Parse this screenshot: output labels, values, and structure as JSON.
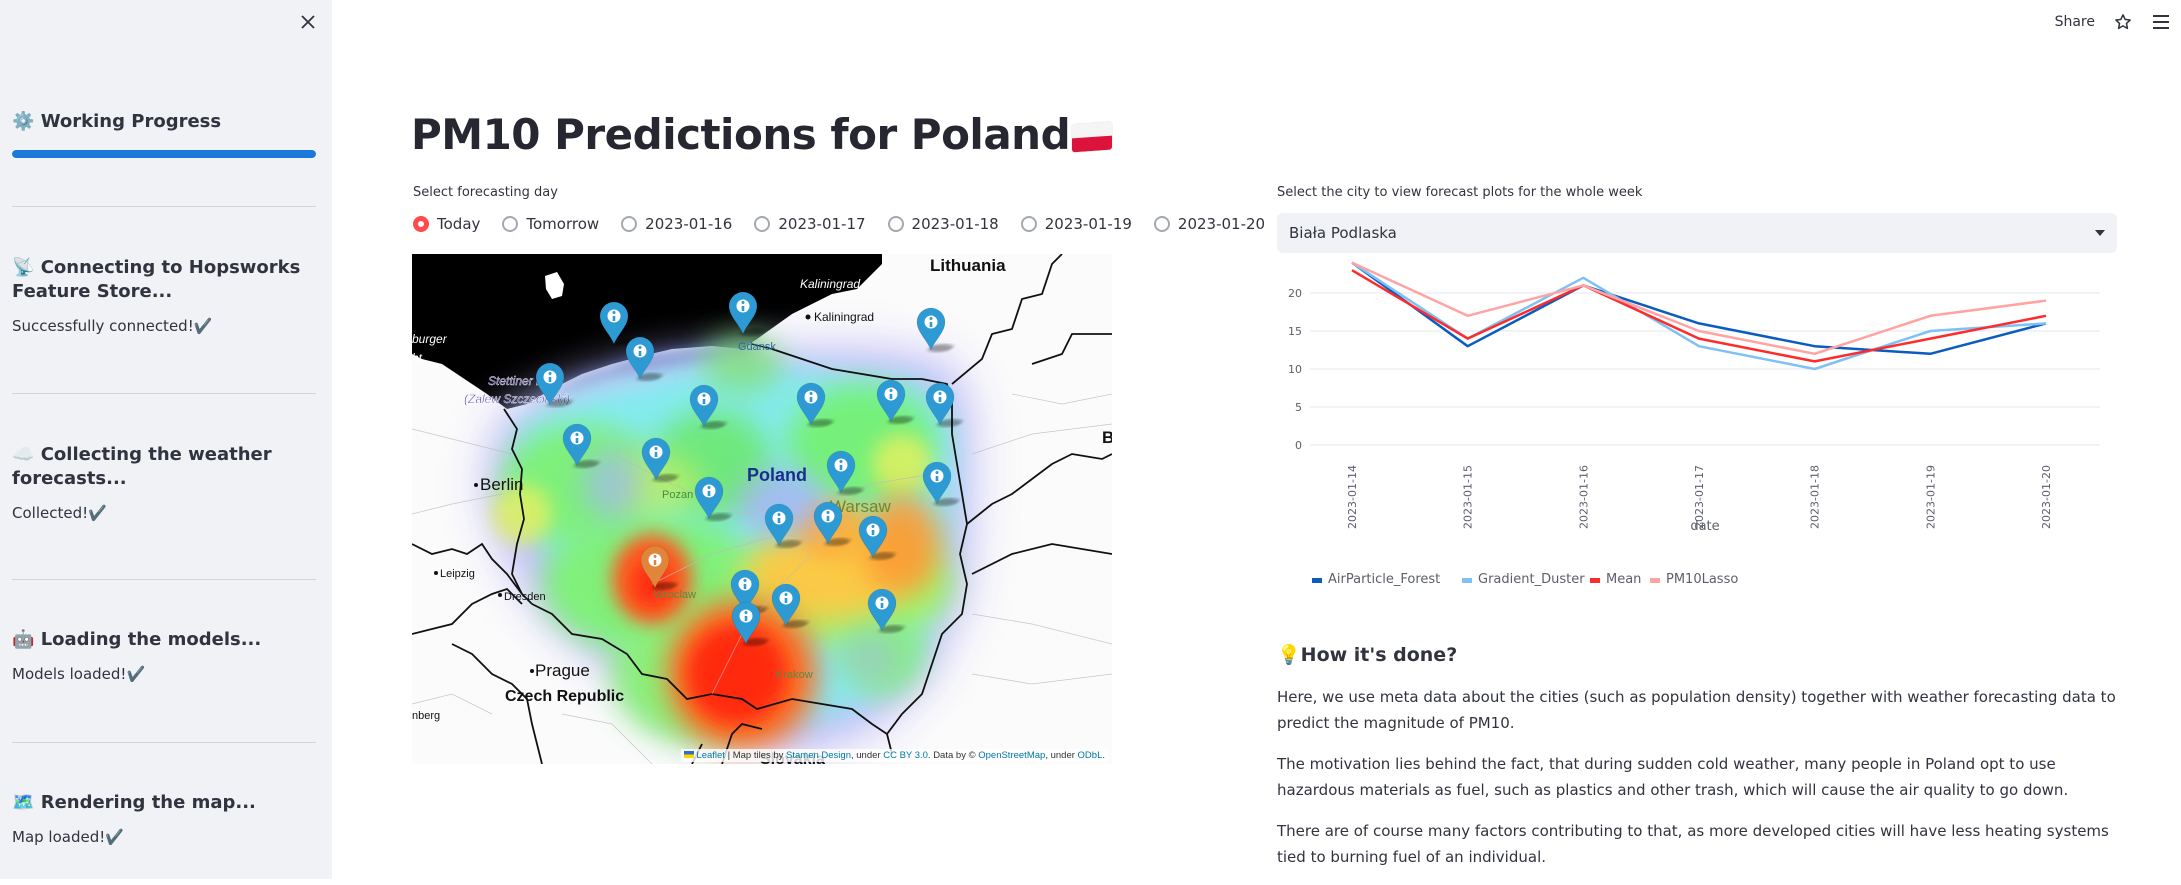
{
  "sidebar": {
    "close_icon": "close-icon",
    "progress_title": "Working Progress",
    "progress_icon": "gear-icon",
    "progress_value": 1.0,
    "sections": [
      {
        "icon": "satellite-dish-icon",
        "emoji": "📡",
        "title": "Connecting to Hopsworks Feature Store...",
        "status": "Successfully connected!✔️"
      },
      {
        "icon": "cloud-icon",
        "emoji": "☁️",
        "title": "Collecting the weather forecasts...",
        "status": "Collected!✔️"
      },
      {
        "icon": "robot-icon",
        "emoji": "🤖",
        "title": "Loading the models...",
        "status": "Models loaded!✔️"
      },
      {
        "icon": "map-icon",
        "emoji": "🗺️",
        "title": "Rendering the map...",
        "status": "Map loaded!✔️"
      }
    ]
  },
  "topbar": {
    "share_label": "Share",
    "star_icon": "star-icon",
    "menu_icon": "hamburger-menu-icon"
  },
  "main": {
    "title": "PM10 Predictions for Poland",
    "title_flag": "poland-flag-icon",
    "forecast_day_label": "Select forecasting day",
    "forecast_days": [
      {
        "label": "Today",
        "selected": true
      },
      {
        "label": "Tomorrow",
        "selected": false
      },
      {
        "label": "2023-01-16",
        "selected": false
      },
      {
        "label": "2023-01-17",
        "selected": false
      },
      {
        "label": "2023-01-18",
        "selected": false
      },
      {
        "label": "2023-01-19",
        "selected": false
      },
      {
        "label": "2023-01-20",
        "selected": false
      }
    ],
    "map": {
      "labels": {
        "lithuania": "Lithuania",
        "kaliningrad_region": "Kaliningrad",
        "kaliningrad_city": "Kaliningrad",
        "gdansk": "Gdansk",
        "stettiner_haff": "Stettiner Haff",
        "zalew": "(Zalew Szczecinski)",
        "burger": "burger",
        "ht": "ht.",
        "berlin": "Berlin",
        "poland": "Poland",
        "pozan": "Pozan",
        "warsaw": "Warsaw",
        "leipzig": "Leipzig",
        "dresden": "Dresden",
        "wroclaw": "Wroclaw",
        "krakow": "Krakow",
        "prague": "Prague",
        "czech": "Czech Republic",
        "nberg": "nberg",
        "slovakia": "Slovakia",
        "b": "B"
      },
      "attribution": {
        "leaflet": "Leaflet",
        "sep": " | Map tiles by ",
        "stamen": "Stamen Design",
        "under1": ", under ",
        "ccby": "CC BY 3.0",
        "databy": ". Data by © ",
        "osm": "OpenStreetMap",
        "under2": ", under ",
        "odbl": "ODbL",
        "end": "."
      },
      "marker_colors": {
        "default": "#2d9ad3",
        "highlight": "#e0853a"
      }
    },
    "city_select_label": "Select the city to view forecast plots for the whole week",
    "city_selected": "Biała Podlaska",
    "how": {
      "title": "How it's done?",
      "icon": "lightbulb-icon",
      "paragraphs": [
        "Here, we use meta data about the cities (such as population density) together with weather forecasting data to predict the magnitude of PM10.",
        "The motivation lies behind the fact, that during sudden cold weather, many people in Poland opt to use hazardous materials as fuel, such as plastics and other trash, which will cause the air quality to go down.",
        "There are of course many factors contributing to that, as more developed cities will have less heating systems tied to burning fuel of an individual."
      ]
    }
  },
  "chart_data": {
    "type": "line",
    "title": "",
    "xlabel": "date",
    "ylabel": "",
    "categories": [
      "2023-01-14",
      "2023-01-15",
      "2023-01-16",
      "2023-01-17",
      "2023-01-18",
      "2023-01-19",
      "2023-01-20"
    ],
    "yticks": [
      0,
      5,
      10,
      15,
      20
    ],
    "ylim": [
      0,
      25
    ],
    "grid": true,
    "legend": "bottom-left",
    "series": [
      {
        "name": "AirParticle_Forest",
        "color": "#0a5cbf",
        "values": [
          24,
          13,
          21,
          16,
          13,
          12,
          16
        ]
      },
      {
        "name": "Gradient_Duster",
        "color": "#7fc0f5",
        "values": [
          24,
          14,
          22,
          13,
          10,
          15,
          16
        ]
      },
      {
        "name": "Mean",
        "color": "#ff2b2b",
        "values": [
          23,
          14,
          21,
          14,
          11,
          14,
          17
        ]
      },
      {
        "name": "PM10Lasso",
        "color": "#ffa3a3",
        "values": [
          24,
          17,
          21,
          15,
          12,
          17,
          19
        ]
      }
    ]
  }
}
